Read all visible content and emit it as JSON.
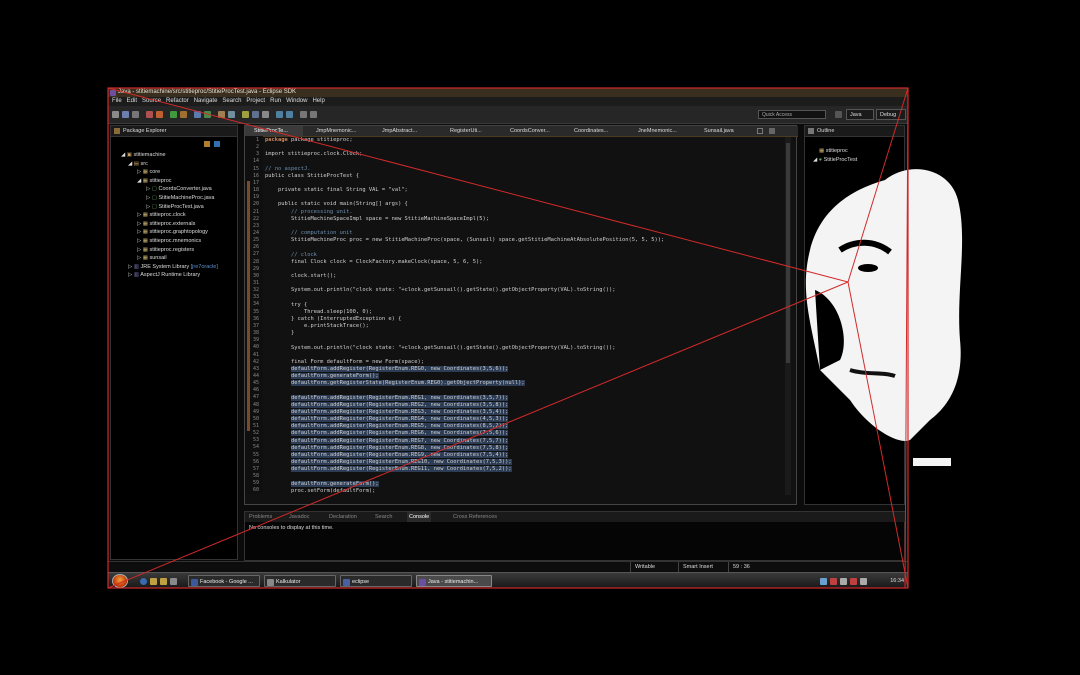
{
  "window": {
    "title": "Java - stitiemachine/src/stitieproc/StitieProcTest.java - Eclipse SDK"
  },
  "menu": [
    "File",
    "Edit",
    "Source",
    "Refactor",
    "Navigate",
    "Search",
    "Project",
    "Run",
    "Window",
    "Help"
  ],
  "toolbar": {
    "quick_access": "Quick Access",
    "perspective_java": "Java",
    "perspective_debug": "Debug"
  },
  "package_explorer": {
    "title": "Package Explorer",
    "items": [
      "stitiemachine",
      "src",
      "core",
      "stitieproc",
      "CoordsConverter.java",
      "StitieMachineProc.java",
      "StitieProcTest.java",
      "stitieproc.clock",
      "stitieproc.externals",
      "stitieproc.graphtopology",
      "stitieproc.mnemonics",
      "stitieproc.registers",
      "sunsail",
      "JRE System Library",
      "[jre7oracle]",
      "AspectJ Runtime Library"
    ]
  },
  "editor": {
    "tabs": [
      "StitieProcTe...",
      "JmpMnemonic...",
      "JmpAbstract...",
      "RegisterUti...",
      "CoordsConver...",
      "Coordinates...",
      "JneMnemonic...",
      "Sunsail.java"
    ],
    "line_numbers": [
      "1",
      "2",
      "3",
      "14",
      "15",
      "16",
      "17",
      "18",
      "19",
      "20",
      "21",
      "22",
      "23",
      "24",
      "25",
      "26",
      "27",
      "28",
      "29",
      "30",
      "31",
      "32",
      "33",
      "34",
      "35",
      "36",
      "37",
      "38",
      "39",
      "40",
      "41",
      "42",
      "43",
      "44",
      "45",
      "46",
      "47",
      "48",
      "49",
      "50",
      "51",
      "52",
      "53",
      "54",
      "55",
      "56",
      "57",
      "58",
      "59",
      "60"
    ],
    "code": {
      "l1": "package stitieproc;",
      "l3": "import stitieproc.clock.Clock;",
      "l15": "// no aspectJ.",
      "l16": "public class StitieProcTest {",
      "l18": "private static final String VAL = \"val\";",
      "l20": "public static void main(String[] args) {",
      "l21": "// processing unit.",
      "l22": "StitieMachineSpaceImpl space = new StitieMachineSpaceImpl(5);",
      "l24": "// computation unit",
      "l25": "StitieMachineProc proc = new StitieMachineProc(space, (Sunsail) space.getStitieMachineAtAbsolutePosition(5, 5, 5));",
      "l27": "// clock",
      "l28": "final Clock clock = ClockFactory.makeClock(space, 5, 6, 5);",
      "l30": "clock.start();",
      "l32": "System.out.println(\"clock state: \"+clock.getSunsail().getState().getObjectProperty(VAL).toString());",
      "l34": "try {",
      "l35": "Thread.sleep(100, 0);",
      "l36": "} catch (InterruptedException e) {",
      "l37": "e.printStackTrace();",
      "l38": "}",
      "l40": "System.out.println(\"clock state: \"+clock.getSunsail().getState().getObjectProperty(VAL).toString());",
      "l42": "final Form defaultForm = new Form(space);",
      "l43": "defaultForm.addRegister(RegisterEnum.REG0, new Coordinates(3,5,6));",
      "l44": "defaultForm.generateForm();",
      "l45": "defaultForm.getRegisterState(RegisterEnum.REG0).getObjectProperty(null);",
      "l47": "defaultForm.addRegister(RegisterEnum.REG1, new Coordinates(3,5,7));",
      "l48": "defaultForm.addRegister(RegisterEnum.REG2, new Coordinates(3,5,8));",
      "l49": "defaultForm.addRegister(RegisterEnum.REG3, new Coordinates(3,5,4));",
      "l50": "defaultForm.addRegister(RegisterEnum.REG4, new Coordinates(4,5,3));",
      "l51": "defaultForm.addRegister(RegisterEnum.REG5, new Coordinates(8,5,2));",
      "l52": "defaultForm.addRegister(RegisterEnum.REG6, new Coordinates(7,5,6));",
      "l53": "defaultForm.addRegister(RegisterEnum.REG7, new Coordinates(7,5,7));",
      "l54": "defaultForm.addRegister(RegisterEnum.REG8, new Coordinates(7,5,8));",
      "l55": "defaultForm.addRegister(RegisterEnum.REG9, new Coordinates(7,5,4));",
      "l56": "defaultForm.addRegister(RegisterEnum.REG10, new Coordinates(7,5,3));",
      "l57": "defaultForm.addRegister(RegisterEnum.REG11, new Coordinates(7,5,2));",
      "l59": "defaultForm.generateForm();",
      "l60": "proc.setForm(defaultForm);"
    }
  },
  "outline": {
    "title": "Outline",
    "items": [
      "stitieproc",
      "StitieProcTest"
    ]
  },
  "console": {
    "tabs": [
      "Problems",
      "Javadoc",
      "Declaration",
      "Search",
      "Console",
      "Cross References"
    ],
    "message": "No consoles to display at this time."
  },
  "status": {
    "writable": "Writable",
    "insert_mode": "Smart Insert",
    "position": "59 : 36"
  },
  "taskbar": {
    "buttons": [
      "Facebook - Google ...",
      "Kalkulator",
      "eclipse",
      "Java - stitiemachin..."
    ],
    "clock": "16:34"
  },
  "colors": {
    "accent_line": "#d22a2a",
    "keyword": "#d08860",
    "comment": "#6a8fb0"
  }
}
